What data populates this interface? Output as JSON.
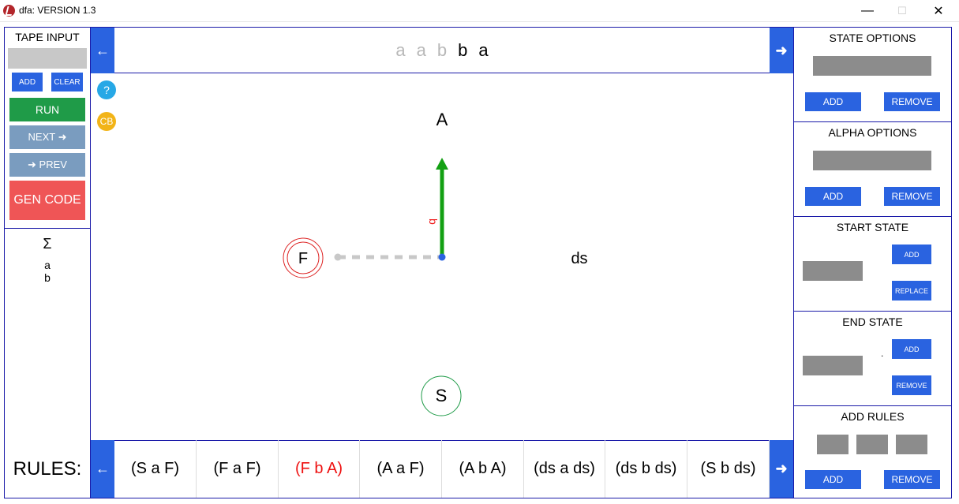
{
  "window": {
    "title": "dfa: VERSION 1.3",
    "minimize": "—",
    "maximize": "☐",
    "close": "✕"
  },
  "left": {
    "tape_input_heading": "TAPE INPUT",
    "tape_input_value": "",
    "add": "ADD",
    "clear": "CLEAR",
    "run": "RUN",
    "next": "NEXT ➜",
    "prev": "➜ PREV",
    "gen_code": "GEN CODE",
    "sigma_heading": "Σ",
    "alphabet": [
      "a",
      "b"
    ]
  },
  "tape": {
    "left_arrow": "←",
    "right_arrow": "➜",
    "consumed": [
      "a",
      "a",
      "b"
    ],
    "remaining": [
      "b",
      "a"
    ]
  },
  "canvas": {
    "help": "?",
    "cb": "CB",
    "states": [
      "A",
      "F",
      "ds",
      "S"
    ],
    "transition_label": "b"
  },
  "rules": {
    "label": "RULES:",
    "left_arrow": "←",
    "right_arrow": "➜",
    "items": [
      "(S a F)",
      "(F a F)",
      "(F b A)",
      "(A a F)",
      "(A b A)",
      "(ds a ds)",
      "(ds b ds)",
      "(S b ds)"
    ]
  },
  "right": {
    "state_options": {
      "heading": "STATE OPTIONS",
      "add": "ADD",
      "remove": "REMOVE"
    },
    "alpha_options": {
      "heading": "ALPHA OPTIONS",
      "add": "ADD",
      "remove": "REMOVE"
    },
    "start_state": {
      "heading": "START STATE",
      "add": "ADD",
      "replace": "REPLACE"
    },
    "end_state": {
      "heading": "END STATE",
      "add": "ADD",
      "remove": "REMOVE",
      "dot": "."
    },
    "add_rules": {
      "heading": "ADD RULES",
      "add": "ADD",
      "remove": "REMOVE"
    }
  },
  "colors": {
    "accent_blue": "#2a63e0",
    "run_green": "#1f9b48",
    "nav_steel": "#7a9cbf",
    "gen_red": "#ef5556",
    "transition_green": "#13a013",
    "active_rule_red": "#e11111"
  }
}
